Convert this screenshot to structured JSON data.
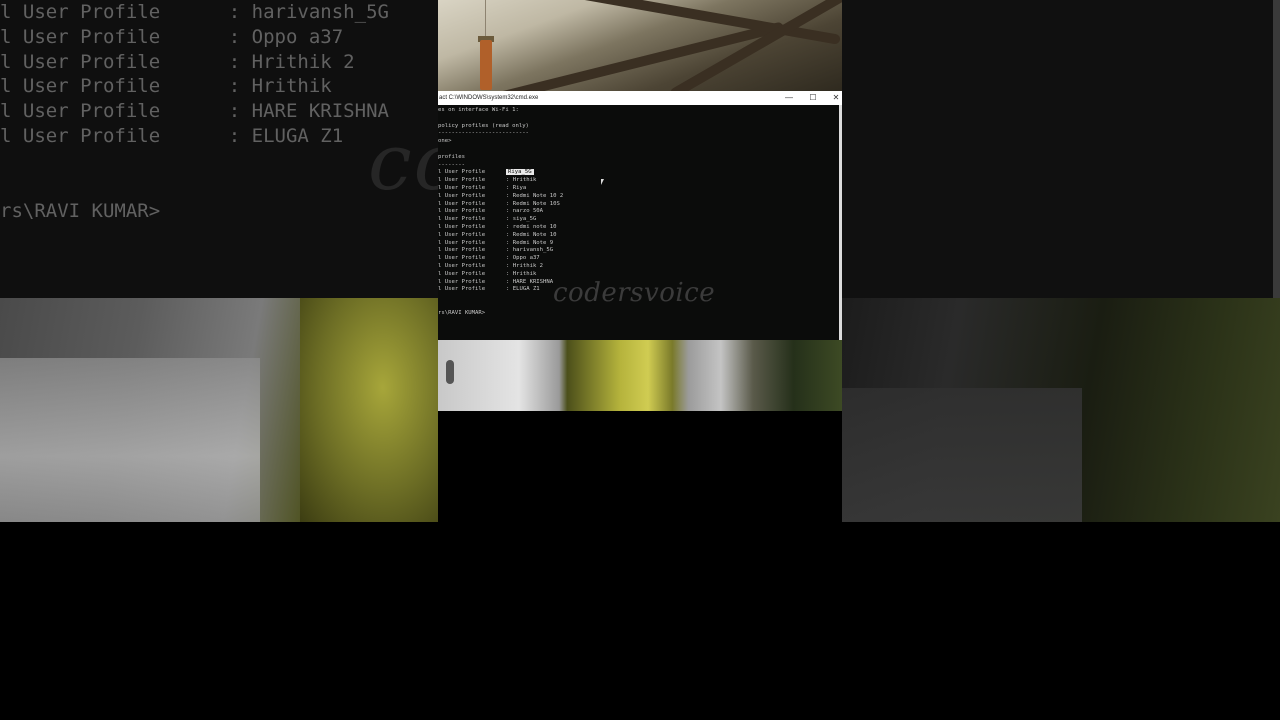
{
  "background": {
    "ghost_lines": [
      {
        "label": "l User Profile",
        "value": ": harivansh_5G"
      },
      {
        "label": "l User Profile",
        "value": ": Oppo a37"
      },
      {
        "label": "l User Profile",
        "value": ": Hrithik 2"
      },
      {
        "label": "l User Profile",
        "value": ": Hrithik"
      },
      {
        "label": "l User Profile",
        "value": ": HARE KRISHNA"
      },
      {
        "label": "l User Profile",
        "value": ": ELUGA Z1"
      }
    ],
    "ghost_prompt": "rs\\RAVI KUMAR>",
    "watermark": "codersvoice"
  },
  "window": {
    "title": "act C:\\WINDOWS\\system32\\cmd.exe",
    "minimize_glyph": "—",
    "maximize_glyph": "☐",
    "close_glyph": "✕"
  },
  "console": {
    "header_line": "es on interface Wi-Fi 1:",
    "policy_heading": "policy profiles (read only)",
    "policy_rule": "---------------------------",
    "policy_none": "one>",
    "profiles_heading": "profiles",
    "profiles_rule": "--------",
    "highlighted_profile": "Riya_5G",
    "profiles": [
      {
        "label": "l User Profile",
        "value": ": Hrithik"
      },
      {
        "label": "l User Profile",
        "value": ": Riya"
      },
      {
        "label": "l User Profile",
        "value": ": Redmi Note 10 2"
      },
      {
        "label": "l User Profile",
        "value": ": Redmi Note 10S"
      },
      {
        "label": "l User Profile",
        "value": ": narzo 50A"
      },
      {
        "label": "l User Profile",
        "value": ": siya_5G"
      },
      {
        "label": "l User Profile",
        "value": ": redmi note 10"
      },
      {
        "label": "l User Profile",
        "value": ": Redmi Note 10"
      },
      {
        "label": "l User Profile",
        "value": ": Redmi Note 9"
      },
      {
        "label": "l User Profile",
        "value": ": harivansh_5G"
      },
      {
        "label": "l User Profile",
        "value": ": Oppo a37"
      },
      {
        "label": "l User Profile",
        "value": ": Hrithik 2"
      },
      {
        "label": "l User Profile",
        "value": ": Hrithik"
      },
      {
        "label": "l User Profile",
        "value": ": HARE KRISHNA"
      },
      {
        "label": "l User Profile",
        "value": ": ELUGA Z1"
      }
    ],
    "first_label": "l User Profile",
    "prompt": "rs\\RAVI KUMAR>",
    "watermark": "codersvoice"
  }
}
